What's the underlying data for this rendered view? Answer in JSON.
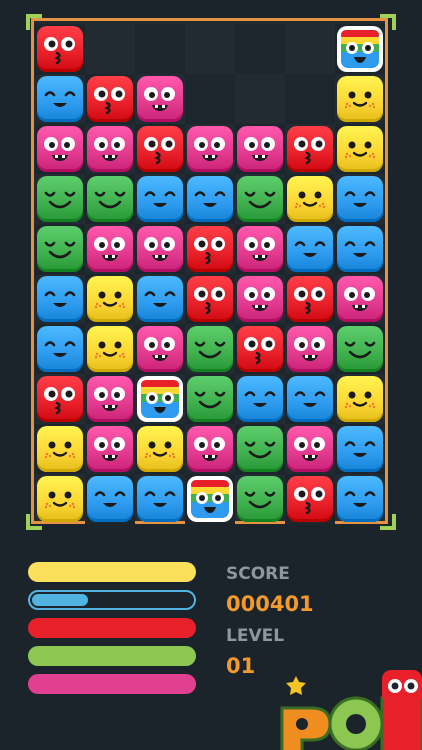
{
  "board": {
    "cols": 7,
    "rows": 10,
    "frame_color": "#e59342",
    "corner_color": "#9fd157",
    "cells": [
      [
        "red-kiss",
        null,
        null,
        null,
        null,
        null,
        "rainbow"
      ],
      [
        "blue-smile",
        "red-kiss",
        "pink-eyes",
        null,
        null,
        null,
        "yellow-blush"
      ],
      [
        "pink-eyes",
        "pink-eyes",
        "red-kiss",
        "pink-eyes",
        "pink-eyes",
        "red-kiss",
        "yellow-blush"
      ],
      [
        "green-smile",
        "green-smile",
        "blue-smile",
        "blue-smile",
        "green-smile",
        "yellow-blush",
        "blue-smile"
      ],
      [
        "green-smile",
        "pink-eyes",
        "pink-eyes",
        "red-kiss",
        "pink-eyes",
        "blue-smile",
        "blue-smile"
      ],
      [
        "blue-smile",
        "yellow-blush",
        "blue-smile",
        "red-kiss",
        "pink-eyes",
        "red-kiss",
        "pink-eyes"
      ],
      [
        "blue-smile",
        "yellow-blush",
        "pink-eyes",
        "green-smile",
        "red-kiss",
        "pink-eyes",
        "green-smile"
      ],
      [
        "red-kiss",
        "pink-eyes",
        "rainbow",
        "green-smile",
        "blue-smile",
        "blue-smile",
        "yellow-blush"
      ],
      [
        "yellow-blush",
        "pink-eyes",
        "yellow-blush",
        "pink-eyes",
        "green-smile",
        "pink-eyes",
        "blue-smile"
      ],
      [
        "yellow-blush",
        "blue-smile",
        "blue-smile",
        "rainbow",
        "green-smile",
        "red-kiss",
        "blue-smile"
      ]
    ]
  },
  "piece_colors": {
    "red": "#e8202a",
    "blue": "#2e9bef",
    "pink": "#e23a8e",
    "green": "#3fb04d",
    "yellow": "#fcd633"
  },
  "bars": [
    {
      "color": "#f9df5a",
      "level": 1.0
    },
    {
      "color": "#53b3e0",
      "level": 0.35
    },
    {
      "color": "#e8202a",
      "level": 1.0
    },
    {
      "color": "#8cc751",
      "level": 1.0
    },
    {
      "color": "#e0408f",
      "level": 1.0
    }
  ],
  "score": {
    "label": "SCORE",
    "value": "000401",
    "label_color": "#8f969c",
    "value_color": "#f29a2e"
  },
  "level": {
    "label": "LEVEL",
    "value": "01",
    "label_color": "#8f969c",
    "value_color": "#f29a2e"
  },
  "logo": {
    "text": "POP",
    "icon": "pop-logo-icon"
  }
}
